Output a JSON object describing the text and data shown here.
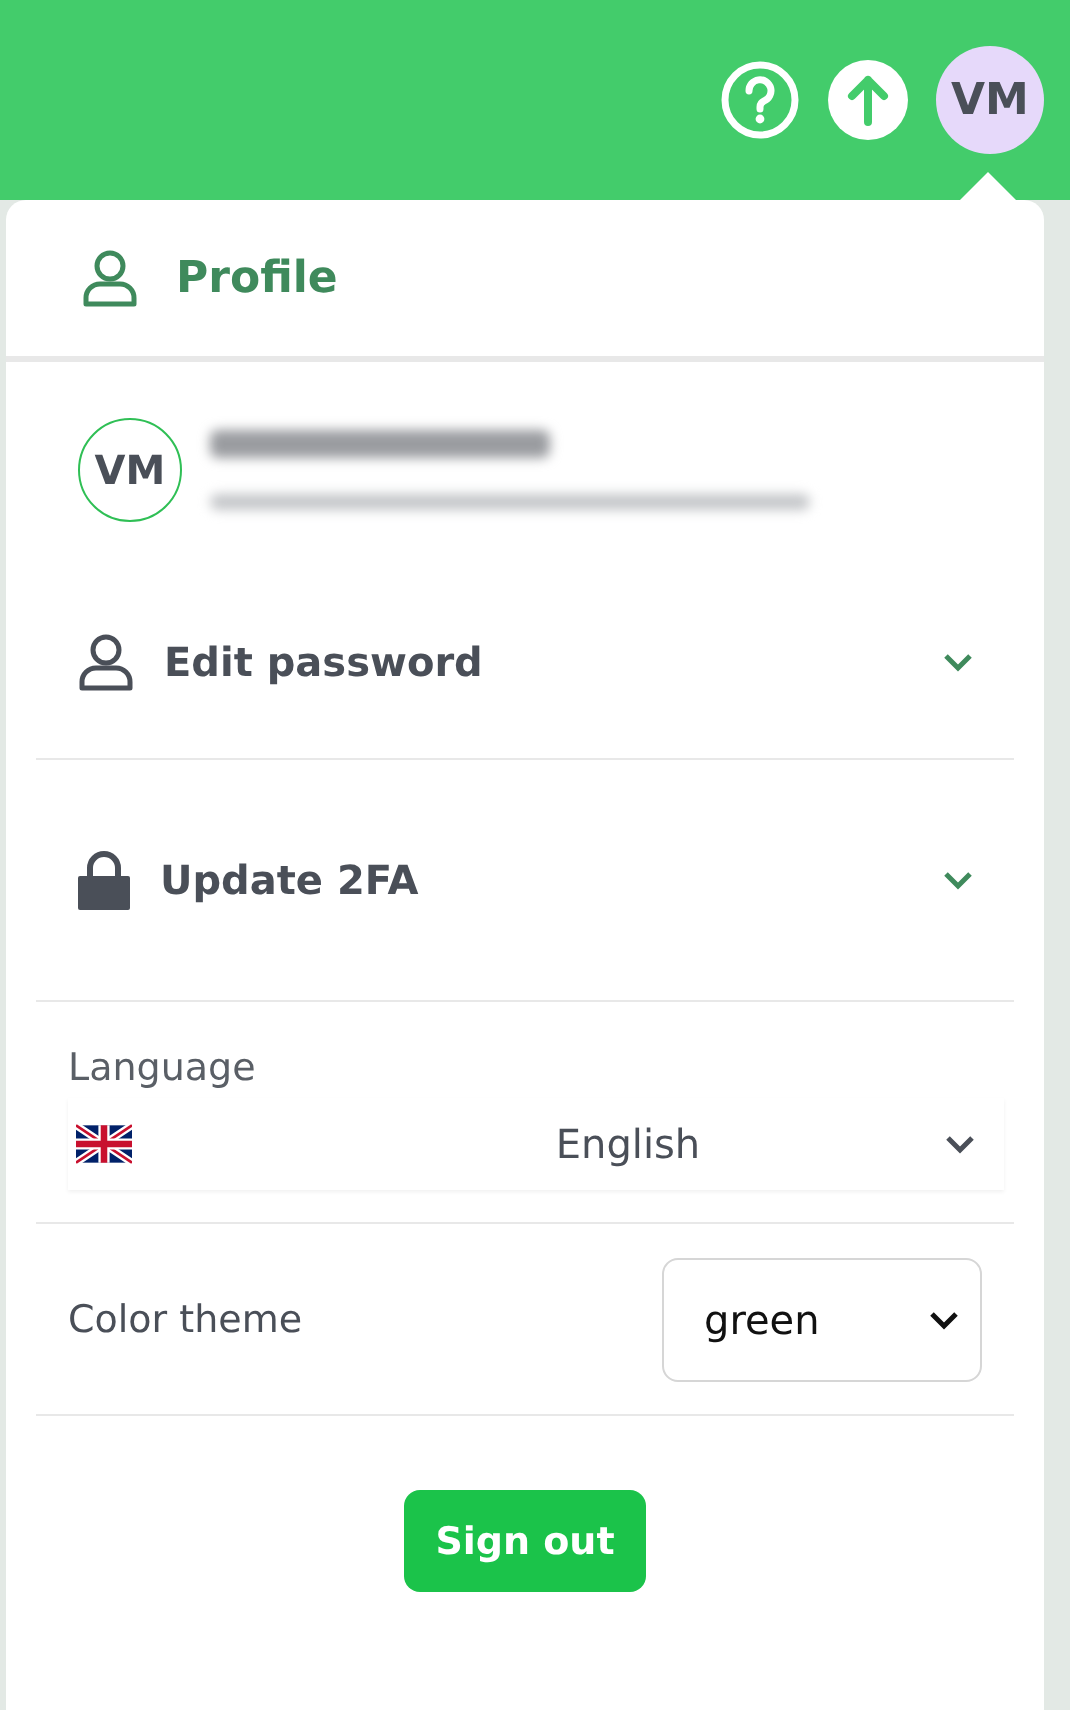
{
  "header": {
    "avatar_initials": "VM"
  },
  "profile_menu": {
    "title": "Profile",
    "user": {
      "initials": "VM"
    },
    "sections": [
      {
        "kind": "password",
        "label": "Edit password",
        "expanded": false
      },
      {
        "kind": "lock",
        "label": "Update 2FA",
        "expanded": false
      }
    ],
    "language": {
      "label": "Language",
      "value": "English"
    },
    "color_theme": {
      "label": "Color theme",
      "value": "green"
    },
    "sign_out": "Sign out"
  }
}
